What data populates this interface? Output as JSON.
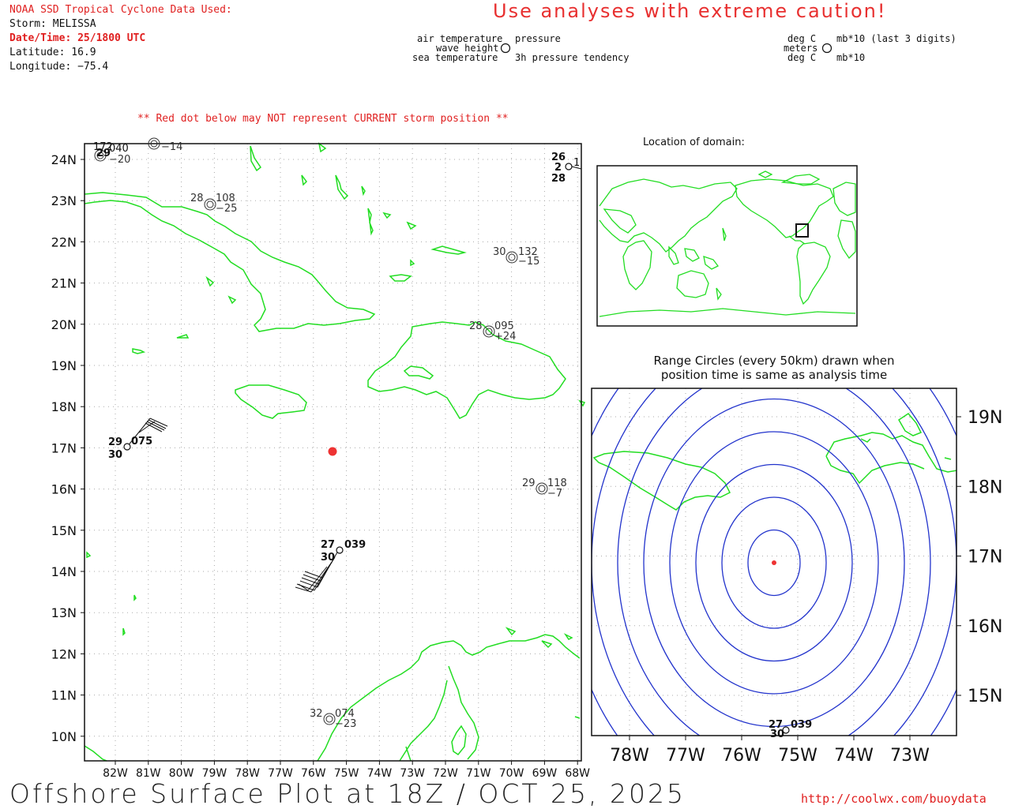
{
  "header": {
    "source_title": "NOAA SSD Tropical Cyclone Data Used:",
    "storm": "Storm: MELISSA",
    "datetime": "Date/Time: 25/1800 UTC",
    "latitude": "Latitude: 16.9",
    "longitude": "Longitude: −75.4",
    "caution": "Use analyses with extreme caution!"
  },
  "station_legend": {
    "air_temperature": "air temperature",
    "pressure": "pressure",
    "wave_height": "wave height",
    "sea_temperature": "sea temperature",
    "pressure_tendency": "3h pressure tendency",
    "air_temp_unit": "deg C",
    "pressure_unit": "mb*10 (last 3 digits)",
    "wave_unit": "meters",
    "sea_temp_unit": "deg C",
    "tendency_unit": "mb*10"
  },
  "warning_note": "** Red dot below may NOT represent CURRENT storm position **",
  "main_map": {
    "lat_labels": [
      "24N",
      "23N",
      "22N",
      "21N",
      "20N",
      "19N",
      "18N",
      "17N",
      "16N",
      "15N",
      "14N",
      "13N",
      "12N",
      "11N",
      "10N"
    ],
    "lon_labels": [
      "82W",
      "81W",
      "80W",
      "79W",
      "78W",
      "77W",
      "76W",
      "75W",
      "74W",
      "73W",
      "72W",
      "71W",
      "70W",
      "69W",
      "68W"
    ],
    "stations": [
      {
        "id": "s1",
        "temp": "",
        "press": "040",
        "sst": "29",
        "tend": "−20"
      },
      {
        "id": "s2",
        "temp": "",
        "press": "",
        "sst": "",
        "tend": "−14"
      },
      {
        "id": "s3",
        "temp": "28",
        "press": "108",
        "sst": "",
        "tend": "−25"
      },
      {
        "id": "s4",
        "temp": "26",
        "press": "1",
        "sst": "28",
        "wave": "2"
      },
      {
        "id": "s5",
        "temp": "30",
        "press": "132",
        "sst": "",
        "tend": "−15"
      },
      {
        "id": "s6",
        "temp": "28",
        "press": "095",
        "sst": "",
        "tend": "+24"
      },
      {
        "id": "s7",
        "temp": "29",
        "press": "075",
        "sst": "30",
        "tend": ""
      },
      {
        "id": "s8",
        "temp": "29",
        "press": "118",
        "sst": "",
        "tend": "−7"
      },
      {
        "id": "s9",
        "temp": "27",
        "press": "039",
        "sst": "30",
        "tend": ""
      },
      {
        "id": "s10",
        "temp": "32",
        "press": "074",
        "sst": "",
        "tend": "−23"
      }
    ]
  },
  "inset_location": {
    "title": "Location of domain:"
  },
  "range_map": {
    "title_line1": "Range Circles (every 50km) drawn when",
    "title_line2": "position time is same as analysis time",
    "lat_labels": [
      "19N",
      "18N",
      "17N",
      "16N",
      "15N"
    ],
    "lon_labels": [
      "78W",
      "77W",
      "76W",
      "75W",
      "74W",
      "73W"
    ],
    "station": {
      "temp": "27",
      "press": "039",
      "sst": "30"
    }
  },
  "footer": {
    "title": "Offshore Surface Plot at 18Z / OCT 25, 2025",
    "url": "http://coolwx.com/buoydata"
  },
  "colors": {
    "land": "#22dd22",
    "storm": "#ee3333",
    "range_circle": "#2233cc",
    "grid": "#999999"
  }
}
